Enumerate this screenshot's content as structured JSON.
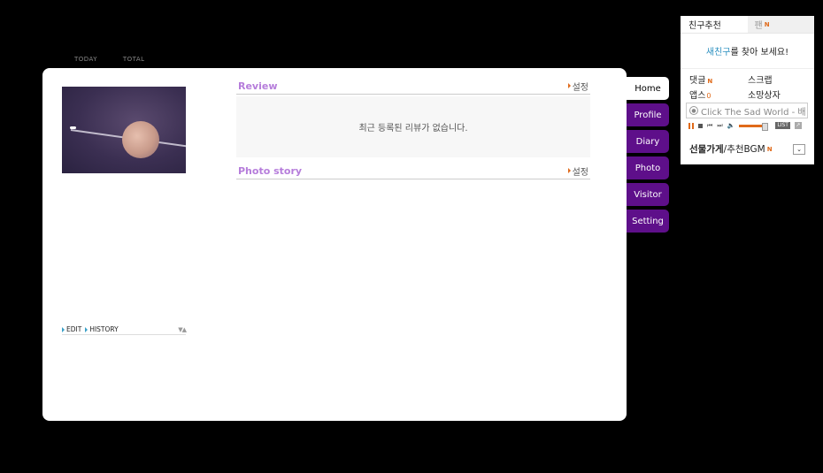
{
  "counter": {
    "today_label": "TODAY",
    "total_label": "TOTAL"
  },
  "profile": {
    "edit_label": "EDIT",
    "history_label": "HISTORY",
    "arrows": "▼▲"
  },
  "review": {
    "title": "Review",
    "setting_label": "설정",
    "empty_message": "최근 등록된 리뷰가 없습니다."
  },
  "photo_story": {
    "title": "Photo story",
    "setting_label": "설정"
  },
  "tabs": [
    {
      "label": "Home",
      "active": true
    },
    {
      "label": "Profile"
    },
    {
      "label": "Diary"
    },
    {
      "label": "Photo"
    },
    {
      "label": "Visitor"
    },
    {
      "label": "Setting"
    }
  ],
  "panel": {
    "tab_friends": "친구추천",
    "tab_fan": "팬",
    "new_badge": "N",
    "find_highlight": "새친구",
    "find_rest": "를 찾아 보세요!",
    "comments": "댓글",
    "scrap": "스크랩",
    "apps": "앱스",
    "apps_count": "0",
    "wish_box": "소망상자",
    "player_text": "Click The Sad World - 배",
    "list_label": "LIST",
    "gift_shop": "선물가게",
    "separator": " / ",
    "recommend_bgm": "추천BGM",
    "colors": {
      "accent": "#e06a1a",
      "tab_purple": "#5e0f8a",
      "section_title": "#b67ddb",
      "link_blue": "#2b8fbf"
    }
  }
}
